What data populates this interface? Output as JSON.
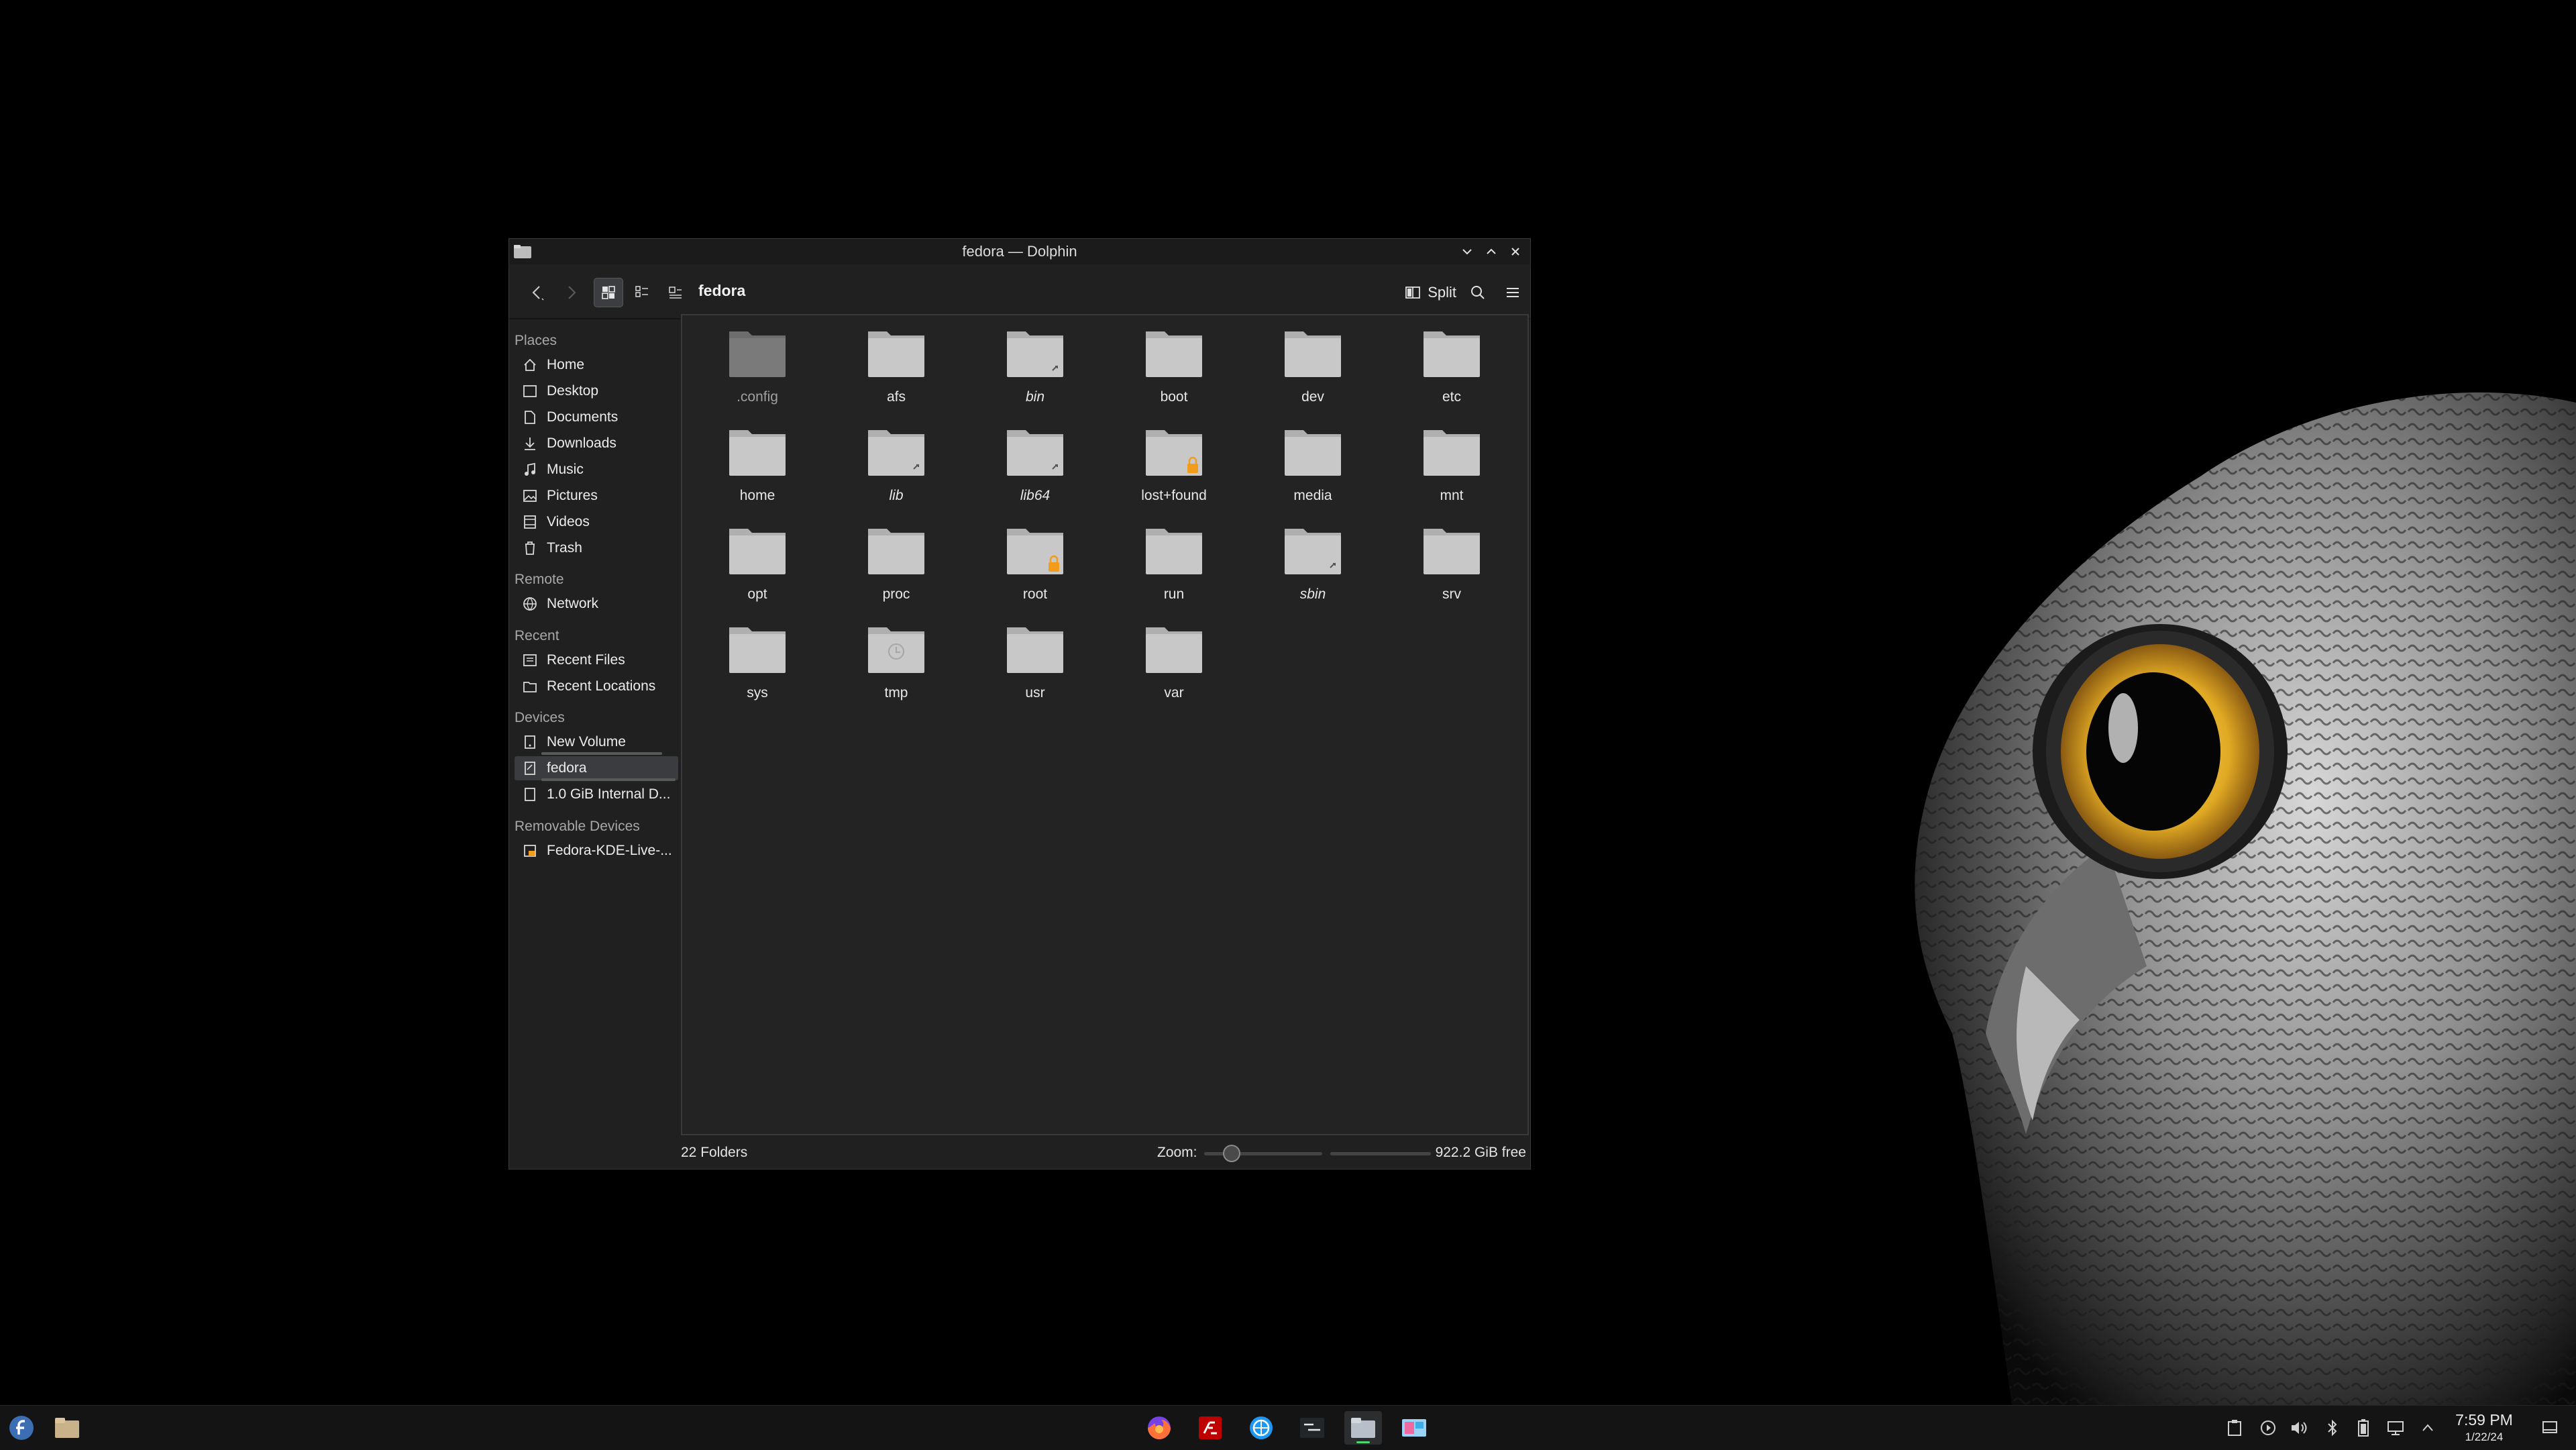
{
  "window": {
    "title": "fedora — Dolphin"
  },
  "toolbar": {
    "path": "fedora",
    "split_label": "Split"
  },
  "sidebar": {
    "places_title": "Places",
    "places": [
      "Home",
      "Desktop",
      "Documents",
      "Downloads",
      "Music",
      "Pictures",
      "Videos",
      "Trash"
    ],
    "remote_title": "Remote",
    "remote": [
      "Network"
    ],
    "recent_title": "Recent",
    "recent": [
      "Recent Files",
      "Recent Locations"
    ],
    "devices_title": "Devices",
    "devices": [
      "New Volume",
      "fedora",
      "1.0 GiB Internal D..."
    ],
    "removable_title": "Removable Devices",
    "removable": [
      "Fedora-KDE-Live-..."
    ]
  },
  "folders": [
    {
      "name": ".config",
      "style": "hidden"
    },
    {
      "name": "afs",
      "style": "normal"
    },
    {
      "name": "bin",
      "style": "link"
    },
    {
      "name": "boot",
      "style": "normal"
    },
    {
      "name": "dev",
      "style": "normal"
    },
    {
      "name": "etc",
      "style": "normal"
    },
    {
      "name": "home",
      "style": "normal"
    },
    {
      "name": "lib",
      "style": "link"
    },
    {
      "name": "lib64",
      "style": "link"
    },
    {
      "name": "lost+found",
      "style": "locked"
    },
    {
      "name": "media",
      "style": "normal"
    },
    {
      "name": "mnt",
      "style": "normal"
    },
    {
      "name": "opt",
      "style": "normal"
    },
    {
      "name": "proc",
      "style": "normal"
    },
    {
      "name": "root",
      "style": "locked"
    },
    {
      "name": "run",
      "style": "normal"
    },
    {
      "name": "sbin",
      "style": "link"
    },
    {
      "name": "srv",
      "style": "normal"
    },
    {
      "name": "sys",
      "style": "normal"
    },
    {
      "name": "tmp",
      "style": "temp"
    },
    {
      "name": "usr",
      "style": "normal"
    },
    {
      "name": "var",
      "style": "normal"
    }
  ],
  "statusbar": {
    "count": "22 Folders",
    "zoom_label": "Zoom:",
    "free_space": "922.2 GiB free"
  },
  "taskbar": {
    "apps": [
      "fedora-launcher-icon",
      "files-icon",
      "firefox-icon",
      "filezilla-icon",
      "kde-discover-icon",
      "terminal-icon",
      "dolphin-icon",
      "screenshot-icon"
    ],
    "time": "7:59 PM",
    "date": "1/22/24"
  },
  "colors": {
    "folder": "#c8c8c8",
    "folder_hidden": "#7a7a7a",
    "lock": "#f29c1b",
    "accent": "#3daee9"
  }
}
